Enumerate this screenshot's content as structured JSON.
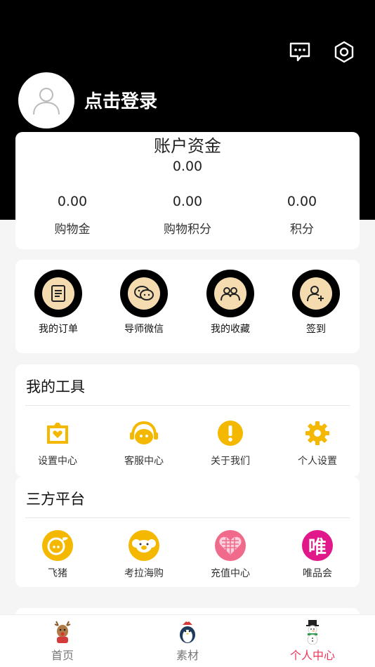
{
  "header": {
    "message_icon": "message-icon",
    "settings_icon": "settings-icon",
    "login_text": "点击登录"
  },
  "account": {
    "title": "账户资金",
    "total": "0.00",
    "items": [
      {
        "value": "0.00",
        "label": "购物金"
      },
      {
        "value": "0.00",
        "label": "购物积分"
      },
      {
        "value": "0.00",
        "label": "积分"
      }
    ]
  },
  "quick_actions": [
    {
      "label": "我的订单",
      "icon": "order-icon"
    },
    {
      "label": "导师微信",
      "icon": "wechat-icon"
    },
    {
      "label": "我的收藏",
      "icon": "favorites-icon"
    },
    {
      "label": "签到",
      "icon": "checkin-icon"
    }
  ],
  "tools": {
    "title": "我的工具",
    "items": [
      {
        "label": "设置中心",
        "icon": "settings-center-icon"
      },
      {
        "label": "客服中心",
        "icon": "headset-icon"
      },
      {
        "label": "关于我们",
        "icon": "exclamation-icon"
      },
      {
        "label": "个人设置",
        "icon": "gear-icon"
      }
    ]
  },
  "platforms": {
    "title": "三方平台",
    "items": [
      {
        "label": "飞猪",
        "icon": "fliggy-icon"
      },
      {
        "label": "考拉海购",
        "icon": "kaola-icon"
      },
      {
        "label": "充值中心",
        "icon": "recharge-icon"
      },
      {
        "label": "唯品会",
        "icon": "vip-icon",
        "glyph": "唯"
      }
    ]
  },
  "tabbar": [
    {
      "label": "首页",
      "icon": "reindeer-icon"
    },
    {
      "label": "素材",
      "icon": "penguin-icon"
    },
    {
      "label": "个人中心",
      "icon": "snowman-icon",
      "active": true
    }
  ],
  "colors": {
    "accent_yellow": "#f5b800",
    "active_tab": "#e8375a",
    "quick_inner": "#f4dcb0"
  }
}
